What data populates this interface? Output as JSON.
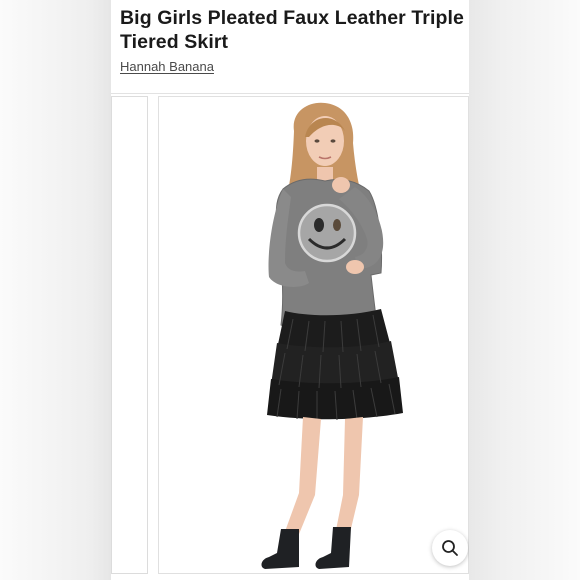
{
  "product": {
    "title_line1": "Big Girls Pleated Faux Leather Triple",
    "title_line2": "Tiered Skirt",
    "brand": "Hannah Banana"
  },
  "gallery": {
    "zoom_icon": "search-icon"
  },
  "colors": {
    "page_bg": "#ffffff",
    "title_text": "#1a1a1a",
    "brand_text": "#4a4a4a",
    "sweater": "#7d7d7d",
    "skirt": "#1c1c1c"
  }
}
